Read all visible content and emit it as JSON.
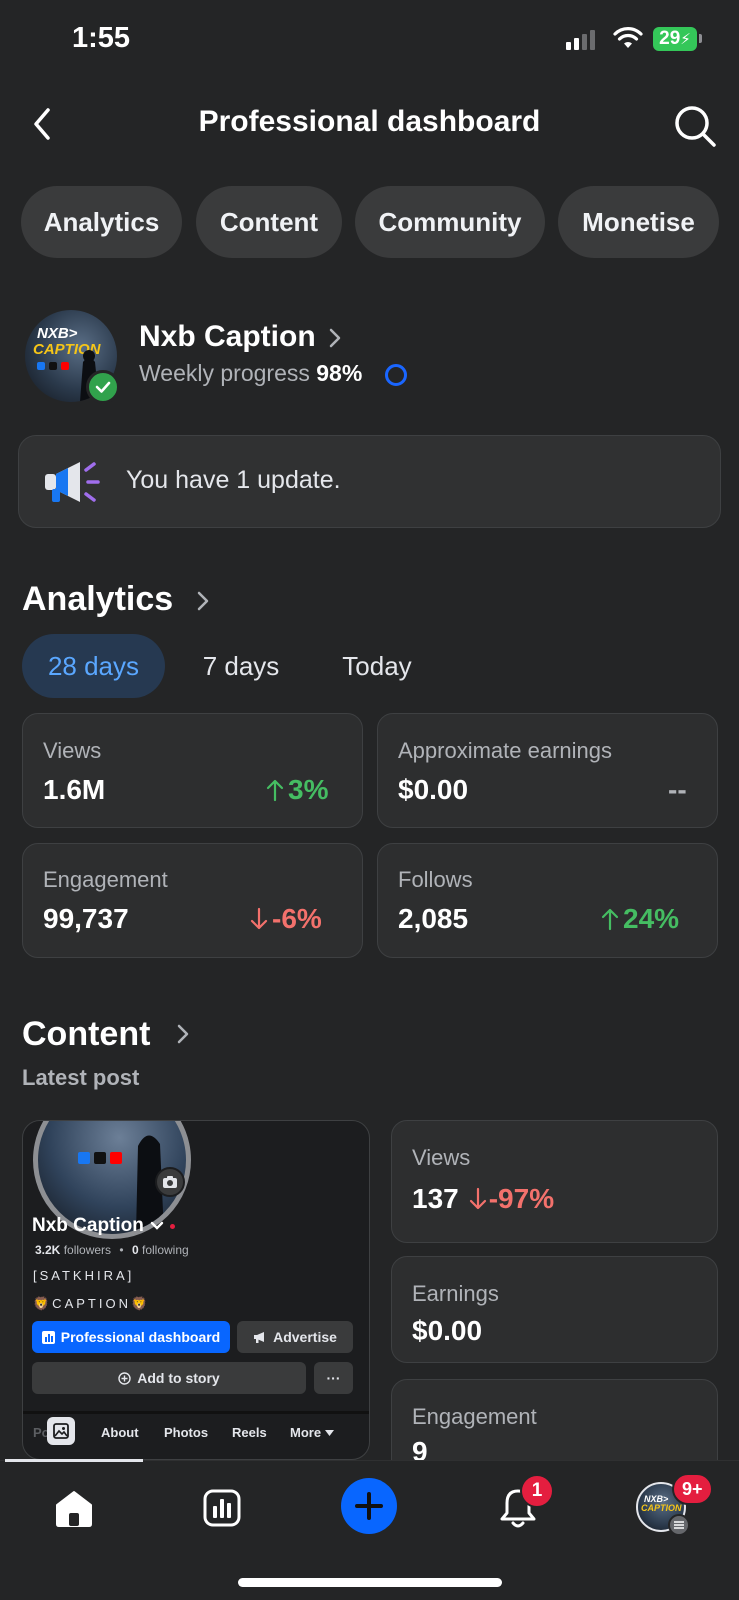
{
  "status_bar": {
    "time": "1:55",
    "battery": "29"
  },
  "header": {
    "title": "Professional dashboard"
  },
  "pills": [
    "Analytics",
    "Content",
    "Community",
    "Monetise"
  ],
  "profile": {
    "name": "Nxb Caption",
    "weekly_label": "Weekly progress",
    "weekly_value": "98%"
  },
  "update": {
    "text": "You have 1 update."
  },
  "analytics": {
    "title": "Analytics",
    "ranges": [
      "28 days",
      "7 days",
      "Today"
    ],
    "active_range": "28 days",
    "cards": [
      {
        "label": "Views",
        "value": "1.6M",
        "change": "3%",
        "direction": "up"
      },
      {
        "label": "Approximate earnings",
        "value": "$0.00",
        "change": "--",
        "direction": "none"
      },
      {
        "label": "Engagement",
        "value": "99,737",
        "change": "-6%",
        "direction": "down"
      },
      {
        "label": "Follows",
        "value": "2,085",
        "change": "24%",
        "direction": "up"
      }
    ]
  },
  "content": {
    "title": "Content",
    "latest_label": "Latest post",
    "post": {
      "name": "Nxb Caption",
      "followers": "3.2K",
      "followers_label": "followers",
      "following": "0",
      "following_label": "following",
      "bio_line1": "[SATKHIRA]",
      "bio_line2": "🦁CAPTION🦁",
      "primary_button": "Professional dashboard",
      "advertise_button": "Advertise",
      "story_button": "Add to story",
      "more_button": "···",
      "tabs": [
        "Posts",
        "About",
        "Photos",
        "Reels",
        "More"
      ]
    },
    "metrics": [
      {
        "label": "Views",
        "value": "137",
        "change": "-97%",
        "direction": "down"
      },
      {
        "label": "Earnings",
        "value": "$0.00"
      },
      {
        "label": "Engagement",
        "value": "9"
      }
    ]
  },
  "nav": {
    "notification_count": "1",
    "profile_badge": "9+"
  },
  "colors": {
    "accent": "#0866ff",
    "positive": "#45bd62",
    "negative": "#f3716c",
    "background": "#242526"
  }
}
